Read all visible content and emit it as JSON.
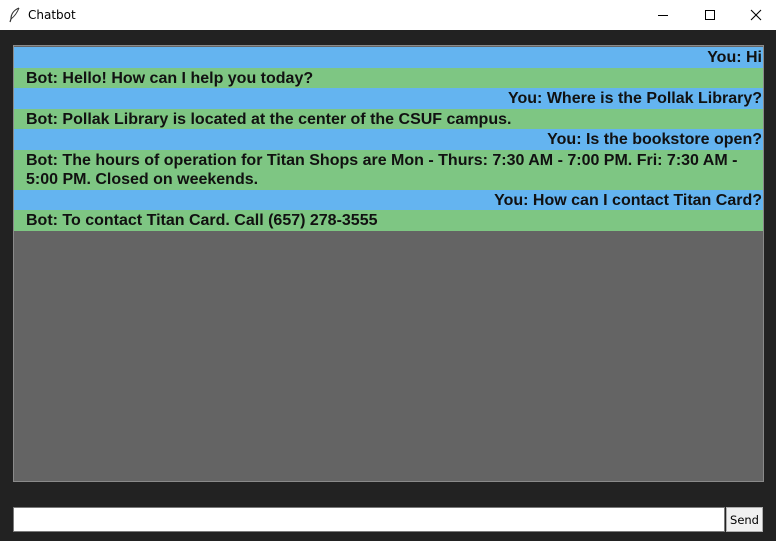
{
  "window": {
    "title": "Chatbot",
    "icons": [
      "feather-icon",
      "minimize-icon",
      "maximize-icon",
      "close-icon"
    ]
  },
  "chat": {
    "colors": {
      "user_bg": "#64b4f0",
      "bot_bg": "#7ec683",
      "panel_bg": "#646464"
    },
    "messages": [
      {
        "sender": "user",
        "text": "You: Hi"
      },
      {
        "sender": "bot",
        "text": "Bot: Hello! How can I help you today?"
      },
      {
        "sender": "user",
        "text": "You: Where is the Pollak Library?"
      },
      {
        "sender": "bot",
        "text": "Bot: Pollak Library is located at the center of the CSUF campus."
      },
      {
        "sender": "user",
        "text": "You: Is the bookstore open?"
      },
      {
        "sender": "bot",
        "text": "Bot: The hours of operation for Titan Shops are Mon - Thurs: 7:30 AM - 7:00 PM. Fri: 7:30 AM - 5:00 PM. Closed on weekends."
      },
      {
        "sender": "user",
        "text": "You: How can I contact Titan Card?"
      },
      {
        "sender": "bot",
        "text": "Bot: To contact Titan Card. Call (657) 278-3555"
      }
    ]
  },
  "input": {
    "value": "",
    "send_label": "Send"
  }
}
